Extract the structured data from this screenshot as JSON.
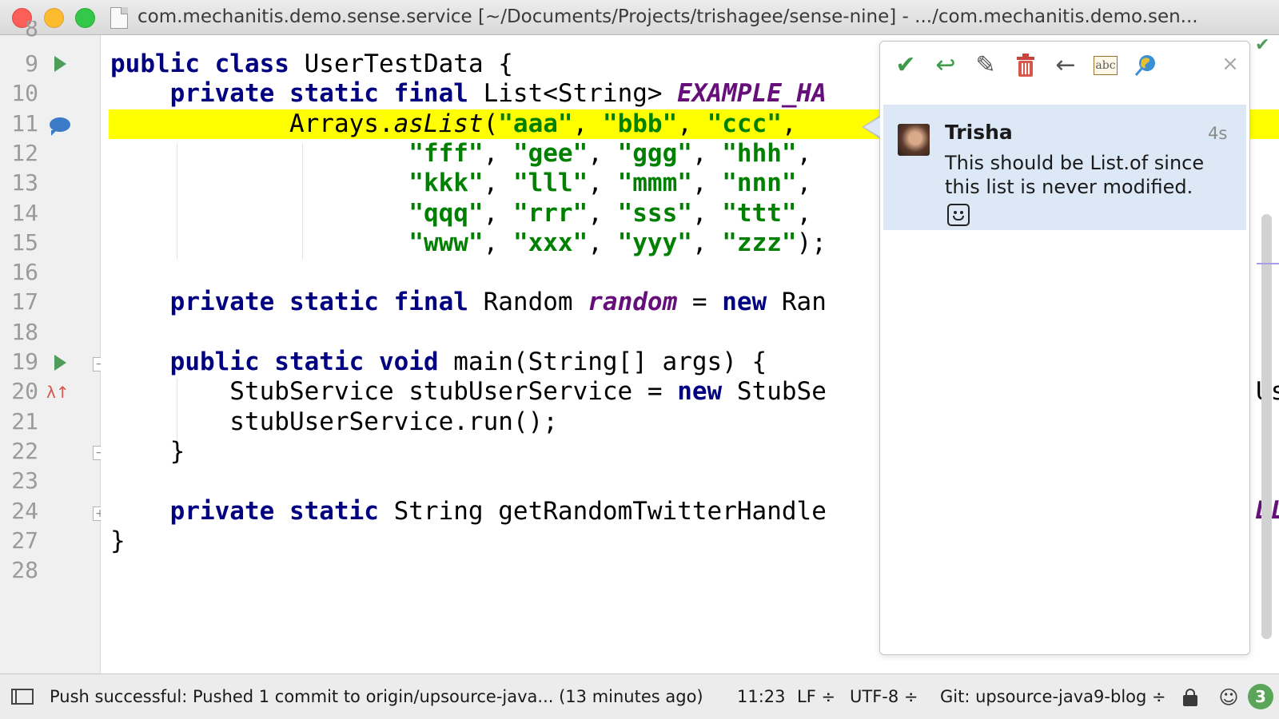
{
  "window": {
    "title": "com.mechanitis.demo.sense.service [~/Documents/Projects/trishagee/sense-nine] - .../com.mechanitis.demo.sen..."
  },
  "gutter": {
    "line_numbers": [
      "9",
      "10",
      "11",
      "12",
      "13",
      "14",
      "15",
      "16",
      "17",
      "18",
      "19",
      "20",
      "21",
      "22",
      "23",
      "24",
      "27",
      "28"
    ],
    "top_partial": "8"
  },
  "editor": {
    "lines": [
      [
        {
          "t": "public class ",
          "c": "kw"
        },
        {
          "t": "UserTestData {",
          "c": ""
        }
      ],
      [
        {
          "t": "    private static final ",
          "c": "kw"
        },
        {
          "t": "List<String> ",
          "c": ""
        },
        {
          "t": "EXAMPLE_HA",
          "c": "fld"
        }
      ],
      [
        {
          "t": "            Arrays.",
          "c": ""
        },
        {
          "t": "asList",
          "c": "mth"
        },
        {
          "t": "(",
          "c": ""
        },
        {
          "t": "\"aaa\"",
          "c": "str"
        },
        {
          "t": ", ",
          "c": ""
        },
        {
          "t": "\"bbb\"",
          "c": "str"
        },
        {
          "t": ", ",
          "c": ""
        },
        {
          "t": "\"ccc\"",
          "c": "str"
        },
        {
          "t": ", ",
          "c": ""
        }
      ],
      [
        {
          "t": "                    ",
          "c": ""
        },
        {
          "t": "\"fff\"",
          "c": "str"
        },
        {
          "t": ", ",
          "c": ""
        },
        {
          "t": "\"gee\"",
          "c": "str"
        },
        {
          "t": ", ",
          "c": ""
        },
        {
          "t": "\"ggg\"",
          "c": "str"
        },
        {
          "t": ", ",
          "c": ""
        },
        {
          "t": "\"hhh\"",
          "c": "str"
        },
        {
          "t": ",",
          "c": ""
        }
      ],
      [
        {
          "t": "                    ",
          "c": ""
        },
        {
          "t": "\"kkk\"",
          "c": "str"
        },
        {
          "t": ", ",
          "c": ""
        },
        {
          "t": "\"lll\"",
          "c": "str"
        },
        {
          "t": ", ",
          "c": ""
        },
        {
          "t": "\"mmm\"",
          "c": "str"
        },
        {
          "t": ", ",
          "c": ""
        },
        {
          "t": "\"nnn\"",
          "c": "str"
        },
        {
          "t": ",",
          "c": ""
        }
      ],
      [
        {
          "t": "                    ",
          "c": ""
        },
        {
          "t": "\"qqq\"",
          "c": "str"
        },
        {
          "t": ", ",
          "c": ""
        },
        {
          "t": "\"rrr\"",
          "c": "str"
        },
        {
          "t": ", ",
          "c": ""
        },
        {
          "t": "\"sss\"",
          "c": "str"
        },
        {
          "t": ", ",
          "c": ""
        },
        {
          "t": "\"ttt\"",
          "c": "str"
        },
        {
          "t": ",",
          "c": ""
        }
      ],
      [
        {
          "t": "                    ",
          "c": ""
        },
        {
          "t": "\"www\"",
          "c": "str"
        },
        {
          "t": ", ",
          "c": ""
        },
        {
          "t": "\"xxx\"",
          "c": "str"
        },
        {
          "t": ", ",
          "c": ""
        },
        {
          "t": "\"yyy\"",
          "c": "str"
        },
        {
          "t": ", ",
          "c": ""
        },
        {
          "t": "\"zzz\"",
          "c": "str"
        },
        {
          "t": ");",
          "c": ""
        }
      ],
      [],
      [
        {
          "t": "    private static final ",
          "c": "kw"
        },
        {
          "t": "Random ",
          "c": ""
        },
        {
          "t": "random",
          "c": "fld"
        },
        {
          "t": " = ",
          "c": ""
        },
        {
          "t": "new ",
          "c": "kw"
        },
        {
          "t": "Ran",
          "c": ""
        }
      ],
      [],
      [
        {
          "t": "    public static void ",
          "c": "kw"
        },
        {
          "t": "main(String[] args) {",
          "c": ""
        }
      ],
      [
        {
          "t": "        StubService stubUserService = ",
          "c": ""
        },
        {
          "t": "new ",
          "c": "kw"
        },
        {
          "t": "StubSe",
          "c": ""
        }
      ],
      [
        {
          "t": "        stubUserService.run();",
          "c": ""
        }
      ],
      [
        {
          "t": "    }",
          "c": ""
        }
      ],
      [],
      [
        {
          "t": "    private static ",
          "c": "kw"
        },
        {
          "t": "String getRandomTwitterHandle",
          "c": ""
        }
      ],
      [
        {
          "t": "}",
          "c": ""
        }
      ],
      []
    ],
    "edge_fragment_line20": "Us",
    "edge_fragment_line24": "DL"
  },
  "review": {
    "toolbar": {
      "resolve_icon": "check-icon",
      "reply_icon": "reply-icon",
      "edit_icon": "pencil-icon",
      "delete_icon": "trash-icon",
      "back_icon": "arrow-left-icon",
      "spell_icon": "abc-icon",
      "upsource_icon": "globe-icon",
      "close_icon": "close-icon",
      "spell_label": "abc"
    },
    "comment": {
      "author": "Trisha",
      "time": "4s",
      "text": "This should be List.of since this list is never modified."
    }
  },
  "status": {
    "message": "Push successful: Pushed 1 commit to origin/upsource-java... (13 minutes ago)",
    "position": "11:23",
    "line_separator": "LF ÷",
    "encoding": "UTF-8 ÷",
    "vcs": "Git: upsource-java9-blog ÷",
    "notifications": "3"
  },
  "colors": {
    "keyword": "#000080",
    "string": "#008000",
    "field": "#660e7a",
    "highlight": "#ffff00",
    "comment_bg": "#dce8f6",
    "accent_green": "#4e9d5a"
  }
}
